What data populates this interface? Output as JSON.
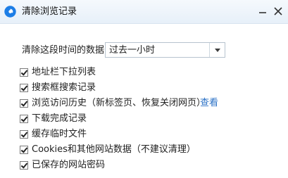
{
  "window": {
    "title": "清除浏览记录",
    "icon": "browser-app-icon",
    "minimize_icon": "minimize-icon",
    "close_icon": "close-icon"
  },
  "time_range": {
    "label": "清除这段时间的数据：",
    "selected": "过去一小时",
    "dropdown_icon": "chevron-down-icon"
  },
  "options": [
    {
      "label": "地址栏下拉列表",
      "checked": true
    },
    {
      "label": "搜索框搜索记录",
      "checked": true
    },
    {
      "label": "浏览访问历史（新标签页、恢复关闭网页）",
      "checked": true,
      "link": "查看"
    },
    {
      "label": "下载完成记录",
      "checked": true
    },
    {
      "label": "缓存临时文件",
      "checked": true
    },
    {
      "label": "Cookies和其他网站数据（不建议清理）",
      "checked": true
    },
    {
      "label": "已保存的网站密码",
      "checked": true
    }
  ],
  "colors": {
    "titlebar_bg": "#e7f0f9",
    "link": "#2a70c5",
    "app_icon": "#1d7ee6"
  }
}
